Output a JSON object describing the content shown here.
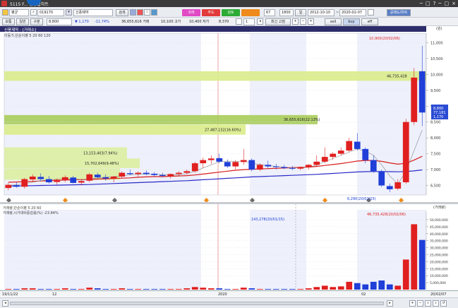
{
  "window": {
    "title": "5115 F... 신종합차트",
    "controls": [
      "─",
      "□",
      "?",
      "─",
      "□",
      "×"
    ]
  },
  "toolbar1": {
    "dropdown1": "평균",
    "code": "019170",
    "name": "신풍제약",
    "search_btn": "검색",
    "btn_pink": "코레",
    "btn_red": "주도",
    "btn_green": "검토",
    "btn_orange": "",
    "period_value": "67",
    "count_value": "1800",
    "range_label": "일",
    "date_from": "2012-10-10",
    "date_to": "2020-02-07",
    "right_btn": "공매도/차트"
  },
  "toolbar2": {
    "b1": "보통",
    "b2": "일반",
    "b3": "구분",
    "price": "8,800",
    "change": "▼ 1,170",
    "change_pct": "-11.74%",
    "volume": "36,655,616 거래",
    "open": "10,100 고가",
    "high": "10,400 저가",
    "low": "8,370",
    "qty": "1",
    "last_btn": "최신 고점",
    "opt1": "sell",
    "opt2": "buy",
    "opt3": "eff"
  },
  "main_panel": {
    "header": "신풍제약 - [거래소]",
    "legend": "이동가,단순이평 5 20 60 120",
    "unit": "(원)",
    "callout_high": "10,900(20/02/06)",
    "callout_low": "6,290(20/02/03)",
    "vp_labels": [
      "46,735,428",
      "36,655,616(22.13%)",
      "27,487,132(16.60%)",
      "13,153,403(7.94%)",
      "15,702,649(9.48%)"
    ],
    "y_ticks": [
      "11,000",
      "10,500",
      "10,000",
      "9,500",
      "9,000",
      "8,500",
      "8,000",
      "7,500",
      "7,000",
      "6,500"
    ],
    "price_tag": "8,800",
    "price_tag2": "77,181",
    "price_tag3": "1,170"
  },
  "sub_panel": {
    "legend1": "거래량,단순이평 5 20 60",
    "legend2": "거래량,시가대비증감률(%) -23.84%",
    "unit": "(거래량)",
    "callout_prev": "143,278(20/01/15)",
    "callout_max": "46,735,428(20/02/06)",
    "y_ticks": [
      "50,000,000",
      "45,000,000",
      "40,000,000",
      "35,000,000",
      "30,000,000",
      "25,000,000",
      "20,000,000",
      "15,000,000",
      "10,000,000",
      "5,000,000"
    ]
  },
  "x_axis": {
    "labels": [
      "19/11/22",
      "12",
      "2020",
      "02",
      "20/02/07"
    ]
  },
  "chart_data": {
    "type": "candlestick",
    "y_range": [
      6200,
      11300
    ],
    "candles": [
      [
        6420,
        6580,
        6350,
        6520
      ],
      [
        6510,
        6600,
        6420,
        6460
      ],
      [
        6460,
        6740,
        6400,
        6700
      ],
      [
        6690,
        6850,
        6600,
        6780
      ],
      [
        6770,
        6880,
        6650,
        6700
      ],
      [
        6700,
        6800,
        6560,
        6600
      ],
      [
        6610,
        6720,
        6530,
        6680
      ],
      [
        6680,
        6820,
        6600,
        6760
      ],
      [
        6750,
        6800,
        6560,
        6580
      ],
      [
        6590,
        6700,
        6500,
        6640
      ],
      [
        6650,
        6900,
        6600,
        6850
      ],
      [
        6840,
        6900,
        6720,
        6760
      ],
      [
        6760,
        6850,
        6650,
        6720
      ],
      [
        6720,
        6800,
        6600,
        6780
      ],
      [
        6780,
        6950,
        6720,
        6900
      ],
      [
        6890,
        7000,
        6820,
        6860
      ],
      [
        6860,
        6950,
        6780,
        6900
      ],
      [
        6900,
        6980,
        6820,
        6860
      ],
      [
        6870,
        6920,
        6780,
        6830
      ],
      [
        6830,
        6900,
        6760,
        6800
      ],
      [
        6800,
        6880,
        6720,
        6860
      ],
      [
        6860,
        6950,
        6800,
        6900
      ],
      [
        6900,
        7000,
        6850,
        6950
      ],
      [
        6950,
        7250,
        6900,
        7200
      ],
      [
        7200,
        7380,
        7050,
        7300
      ],
      [
        7300,
        7450,
        7180,
        7350
      ],
      [
        7360,
        7500,
        7200,
        7250
      ],
      [
        7240,
        7320,
        7050,
        7100
      ],
      [
        7100,
        7300,
        7000,
        7240
      ],
      [
        7240,
        7650,
        7150,
        7300
      ],
      [
        7300,
        7350,
        6950,
        7000
      ],
      [
        7000,
        7200,
        6950,
        7150
      ],
      [
        7150,
        7280,
        7050,
        7100
      ],
      [
        7100,
        7180,
        7000,
        7080
      ],
      [
        7080,
        7150,
        7010,
        7050
      ],
      [
        7050,
        7120,
        6980,
        7030
      ],
      [
        7030,
        7100,
        6980,
        7070
      ],
      [
        7070,
        7180,
        7000,
        7150
      ],
      [
        7150,
        7450,
        7100,
        7250
      ],
      [
        7250,
        7700,
        7200,
        7400
      ],
      [
        7400,
        7550,
        7300,
        7500
      ],
      [
        7500,
        7700,
        7450,
        7600
      ],
      [
        7600,
        8000,
        7550,
        7900
      ],
      [
        7880,
        8150,
        7600,
        7650
      ],
      [
        7650,
        7700,
        7200,
        7300
      ],
      [
        7300,
        7450,
        6900,
        6950
      ],
      [
        6950,
        7000,
        6450,
        6500
      ],
      [
        6480,
        6560,
        6290,
        6380
      ],
      [
        6400,
        6700,
        6350,
        6600
      ],
      [
        6600,
        8600,
        6550,
        8500
      ],
      [
        8500,
        10200,
        8400,
        9900
      ],
      [
        10100,
        10900,
        8370,
        8800
      ]
    ],
    "ma5": [
      6500,
      6520,
      6560,
      6600,
      6650,
      6680,
      6700,
      6720,
      6700,
      6680,
      6700,
      6740,
      6760,
      6780,
      6800,
      6840,
      6850,
      6860,
      6860,
      6840,
      6830,
      6840,
      6870,
      6950,
      7050,
      7150,
      7250,
      7270,
      7260,
      7270,
      7200,
      7160,
      7130,
      7100,
      7080,
      7060,
      7060,
      7080,
      7140,
      7250,
      7350,
      7450,
      7550,
      7650,
      7580,
      7450,
      7150,
      6800,
      6550,
      6950,
      7600,
      8250
    ],
    "ma20": [
      6600,
      6610,
      6620,
      6630,
      6640,
      6650,
      6660,
      6670,
      6680,
      6680,
      6690,
      6700,
      6710,
      6720,
      6730,
      6740,
      6760,
      6770,
      6780,
      6780,
      6790,
      6800,
      6810,
      6830,
      6860,
      6890,
      6920,
      6950,
      6980,
      7000,
      7010,
      7020,
      7030,
      7040,
      7050,
      7060,
      7070,
      7080,
      7100,
      7130,
      7160,
      7190,
      7230,
      7270,
      7290,
      7290,
      7260,
      7210,
      7170,
      7200,
      7300,
      7420
    ],
    "ma60": [
      6480,
      6485,
      6490,
      6495,
      6500,
      6505,
      6510,
      6515,
      6520,
      6525,
      6530,
      6540,
      6550,
      6560,
      6570,
      6580,
      6590,
      6600,
      6610,
      6620,
      6630,
      6640,
      6650,
      6665,
      6680,
      6695,
      6710,
      6725,
      6740,
      6755,
      6770,
      6780,
      6790,
      6800,
      6810,
      6820,
      6830,
      6840,
      6850,
      6865,
      6880,
      6895,
      6910,
      6925,
      6935,
      6940,
      6940,
      6935,
      6930,
      6940,
      6960,
      6990
    ],
    "volume_ratio": [
      0.01,
      0.01,
      0.02,
      0.02,
      0.01,
      0.01,
      0.01,
      0.02,
      0.01,
      0.01,
      0.03,
      0.02,
      0.01,
      0.01,
      0.02,
      0.01,
      0.01,
      0.01,
      0.01,
      0.01,
      0.01,
      0.01,
      0.02,
      0.04,
      0.03,
      0.02,
      0.02,
      0.01,
      0.01,
      0.03,
      0.02,
      0.01,
      0.01,
      0.01,
      0.01,
      0.01,
      0.01,
      0.02,
      0.04,
      0.06,
      0.04,
      0.05,
      0.12,
      0.1,
      0.08,
      0.12,
      0.14,
      0.08,
      0.06,
      0.46,
      1.0,
      0.76
    ],
    "volume_ylim": [
      0,
      52000000
    ]
  }
}
